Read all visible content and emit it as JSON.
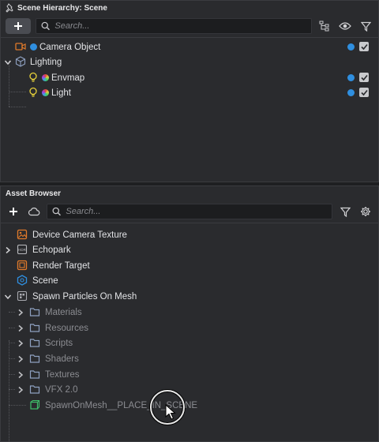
{
  "hierarchy": {
    "title": "Scene Hierarchy: Scene",
    "search_placeholder": "Search...",
    "items": [
      {
        "label": "Camera Object",
        "icon": "camera-icon"
      },
      {
        "label": "Lighting",
        "icon": "group-icon"
      },
      {
        "label": "Envmap",
        "icon": "light-bulb-icon"
      },
      {
        "label": "Light",
        "icon": "light-bulb-icon"
      }
    ]
  },
  "assets": {
    "title": "Asset Browser",
    "search_placeholder": "Search...",
    "items": [
      {
        "label": "Device Camera Texture",
        "icon": "texture-icon"
      },
      {
        "label": "Echopark",
        "icon": "hdr-icon"
      },
      {
        "label": "Render Target",
        "icon": "render-target-icon"
      },
      {
        "label": "Scene",
        "icon": "scene-icon"
      },
      {
        "label": "Spawn Particles On Mesh",
        "icon": "package-icon"
      },
      {
        "label": "Materials",
        "icon": "folder-icon"
      },
      {
        "label": "Resources",
        "icon": "folder-icon"
      },
      {
        "label": "Scripts",
        "icon": "folder-icon"
      },
      {
        "label": "Shaders",
        "icon": "folder-icon"
      },
      {
        "label": "Textures",
        "icon": "folder-icon"
      },
      {
        "label": "VFX 2.0",
        "icon": "folder-icon"
      },
      {
        "label": "SpawnOnMesh__PLACE_IN_SCENE",
        "icon": "prefab-icon"
      }
    ]
  },
  "colors": {
    "accent_blue": "#2f8fe0",
    "orange": "#e07a2a",
    "yellow": "#e8d23a",
    "green": "#3fbf6a"
  }
}
